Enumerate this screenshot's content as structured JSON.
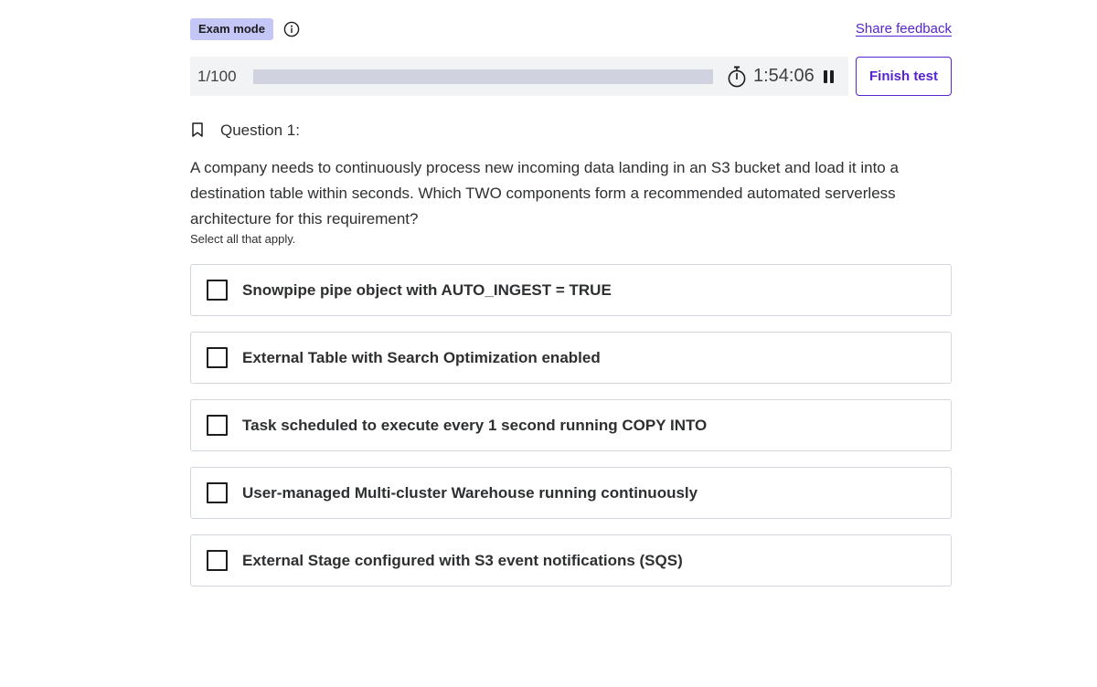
{
  "header": {
    "badge": "Exam mode",
    "share_feedback": "Share feedback"
  },
  "progress": {
    "counter": "1/100",
    "fraction": 0.0,
    "timer": "1:54:06"
  },
  "actions": {
    "finish_label": "Finish test"
  },
  "question": {
    "label": "Question 1:",
    "text": "A company needs to continuously process new incoming data landing in an S3 bucket and load it into a destination table within seconds. Which TWO components form a recommended automated serverless architecture for this requirement?",
    "hint": "Select all that apply.",
    "options": [
      {
        "label": "Snowpipe pipe object with AUTO_INGEST = TRUE"
      },
      {
        "label": "External Table with Search Optimization enabled"
      },
      {
        "label": "Task scheduled to execute every 1 second running COPY INTO"
      },
      {
        "label": "User-managed Multi-cluster Warehouse running continuously"
      },
      {
        "label": "External Stage configured with S3 event notifications (SQS)"
      }
    ]
  },
  "colors": {
    "accent": "#5624d0",
    "badge_bg": "#c4c6f6",
    "progress_track": "#d1d2e0"
  },
  "icons": {
    "info": "info-circle-icon",
    "timer": "stopwatch-icon",
    "pause": "pause-icon",
    "bookmark": "bookmark-icon",
    "checkbox": "checkbox-unchecked-icon"
  }
}
